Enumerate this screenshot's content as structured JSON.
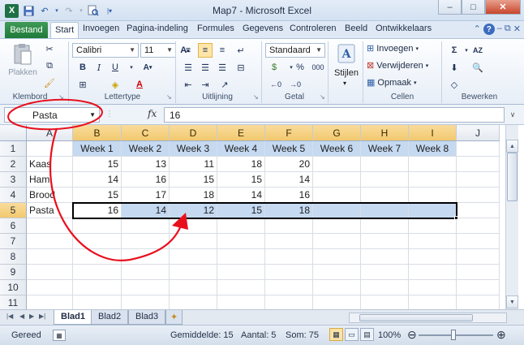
{
  "window": {
    "title": "Map7 - Microsoft Excel",
    "buttons": {
      "minimize": "–",
      "maximize": "□",
      "close": "✕"
    }
  },
  "ribbon_tabs": [
    {
      "label": "Bestand"
    },
    {
      "label": "Start"
    },
    {
      "label": "Invoegen"
    },
    {
      "label": "Pagina-indeling"
    },
    {
      "label": "Formules"
    },
    {
      "label": "Gegevens"
    },
    {
      "label": "Controleren"
    },
    {
      "label": "Beeld"
    },
    {
      "label": "Ontwikkelaars"
    }
  ],
  "ribbon": {
    "clipboard": {
      "paste_label": "Plakken",
      "group_label": "Klembord"
    },
    "font": {
      "name": "Calibri",
      "size": "11",
      "group_label": "Lettertype"
    },
    "alignment": {
      "group_label": "Uitlijning"
    },
    "number": {
      "format": "Standaard",
      "group_label": "Getal",
      "percent": "%",
      "thousands": "000"
    },
    "styles": {
      "label": "Stijlen"
    },
    "cells": {
      "insert": "Invoegen",
      "delete": "Verwijderen",
      "format": "Opmaak",
      "group_label": "Cellen"
    },
    "editing": {
      "group_label": "Bewerken"
    }
  },
  "formula_bar": {
    "name_box": "Pasta",
    "fx": "fx",
    "value": "16"
  },
  "columns": [
    "A",
    "B",
    "C",
    "D",
    "E",
    "F",
    "G",
    "H",
    "I",
    "J"
  ],
  "rows": [
    "1",
    "2",
    "3",
    "4",
    "5",
    "6",
    "7",
    "8",
    "9",
    "10",
    "11"
  ],
  "sheet": {
    "headers": [
      "Week 1",
      "Week 2",
      "Week 3",
      "Week 4",
      "Week 5",
      "Week 6",
      "Week 7",
      "Week 8"
    ],
    "data": [
      {
        "label": "Kaas",
        "values": [
          "15",
          "13",
          "11",
          "18",
          "20"
        ]
      },
      {
        "label": "Ham",
        "values": [
          "14",
          "16",
          "15",
          "15",
          "14"
        ]
      },
      {
        "label": "Brood",
        "values": [
          "15",
          "17",
          "18",
          "14",
          "16"
        ]
      },
      {
        "label": "Pasta",
        "values": [
          "16",
          "14",
          "12",
          "15",
          "18"
        ]
      }
    ]
  },
  "sheet_tabs": [
    {
      "label": "Blad1"
    },
    {
      "label": "Blad2"
    },
    {
      "label": "Blad3"
    }
  ],
  "status": {
    "ready": "Gereed",
    "average": "Gemiddelde: 15",
    "count": "Aantal: 5",
    "sum": "Som: 75",
    "zoom": "100%"
  },
  "colors": {
    "annotation": "#e8101d",
    "selection": "#c5d9f1",
    "header_highlight": "#f2c96f",
    "file_tab": "#1f7a3a"
  },
  "icons": [
    "excel-logo-icon",
    "save-icon",
    "undo-icon",
    "redo-icon",
    "print-preview-icon",
    "help-icon",
    "paste-icon",
    "cut-icon",
    "copy-icon",
    "format-painter-icon",
    "bold-icon",
    "italic-icon",
    "underline-icon",
    "sum-icon",
    "sort-filter-icon",
    "find-icon"
  ]
}
